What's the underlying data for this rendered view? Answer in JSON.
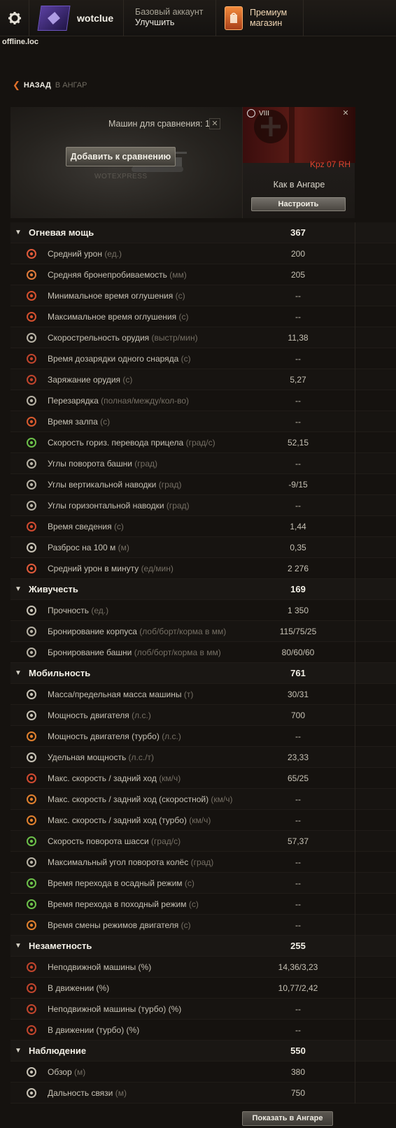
{
  "header": {
    "username": "wotclue",
    "account_type": "Базовый аккаунт",
    "upgrade": "Улучшить",
    "premium_line1": "Премиум",
    "premium_line2": "магазин",
    "server": "offline.loc"
  },
  "nav": {
    "back": "НАЗАД",
    "target": "В АНГАР"
  },
  "compare": {
    "label": "Машин для сравнения: 1",
    "add_button": "Добавить к сравнению",
    "watermark": "WOTEXPRESS"
  },
  "vehicle": {
    "tier": "VIII",
    "name": "Kpz 07 RH",
    "config": "Как в Ангаре",
    "setup_button": "Настроить",
    "accent": "#e0432e"
  },
  "categories": [
    {
      "name": "Огневая мощь",
      "value": "367",
      "stats": [
        {
          "label": "Средний урон",
          "unit": "(ед.)",
          "value": "200",
          "icon": "shell-damage-icon",
          "color": "#e05a3a"
        },
        {
          "label": "Средняя бронепробиваемость",
          "unit": "(мм)",
          "value": "205",
          "icon": "penetration-icon",
          "color": "#e07a3a"
        },
        {
          "label": "Минимальное время оглушения",
          "unit": "(с)",
          "value": "--",
          "icon": "stun-min-icon",
          "color": "#d4502e"
        },
        {
          "label": "Максимальное время оглушения",
          "unit": "(с)",
          "value": "--",
          "icon": "stun-max-icon",
          "color": "#d4502e"
        },
        {
          "label": "Скорострельность орудия",
          "unit": "(выстр/мин)",
          "value": "11,38",
          "icon": "rate-of-fire-icon",
          "color": "#b8b3a6"
        },
        {
          "label": "Время дозарядки одного снаряда",
          "unit": "(с)",
          "value": "--",
          "icon": "shell-reload-icon",
          "color": "#c0442c"
        },
        {
          "label": "Заряжание орудия",
          "unit": "(с)",
          "value": "5,27",
          "icon": "gun-loading-icon",
          "color": "#c0442c"
        },
        {
          "label": "Перезарядка",
          "unit": "(полная/между/кол-во)",
          "value": "--",
          "icon": "magazine-reload-icon",
          "color": "#b8b3a6"
        },
        {
          "label": "Время залпа",
          "unit": "(с)",
          "value": "--",
          "icon": "salvo-icon",
          "color": "#d85a2e"
        },
        {
          "label": "Скорость гориз. перевода прицела",
          "unit": "(град/с)",
          "value": "52,15",
          "icon": "traverse-speed-icon",
          "color": "#6cc04a"
        },
        {
          "label": "Углы поворота башни",
          "unit": "(град)",
          "value": "--",
          "icon": "turret-angle-icon",
          "color": "#b8b3a6"
        },
        {
          "label": "Углы вертикальной наводки",
          "unit": "(град)",
          "value": "-9/15",
          "icon": "elevation-icon",
          "color": "#b8b3a6"
        },
        {
          "label": "Углы горизонтальной наводки",
          "unit": "(град)",
          "value": "--",
          "icon": "horizontal-aim-icon",
          "color": "#b8b3a6"
        },
        {
          "label": "Время сведения",
          "unit": "(с)",
          "value": "1,44",
          "icon": "aim-time-icon",
          "color": "#d04a30"
        },
        {
          "label": "Разброс на 100 м",
          "unit": "(м)",
          "value": "0,35",
          "icon": "dispersion-icon",
          "color": "#c8c3b6"
        },
        {
          "label": "Средний урон в минуту",
          "unit": "(ед/мин)",
          "value": "2 276",
          "icon": "dpm-icon",
          "color": "#e05a3a"
        }
      ]
    },
    {
      "name": "Живучесть",
      "value": "169",
      "stats": [
        {
          "label": "Прочность",
          "unit": "(ед.)",
          "value": "1 350",
          "icon": "hitpoints-icon",
          "color": "#c8c3b6"
        },
        {
          "label": "Бронирование корпуса",
          "unit": "(лоб/борт/корма в мм)",
          "value": "115/75/25",
          "icon": "hull-armor-icon",
          "color": "#b8b3a6"
        },
        {
          "label": "Бронирование башни",
          "unit": "(лоб/борт/корма в мм)",
          "value": "80/60/60",
          "icon": "turret-armor-icon",
          "color": "#b8b3a6"
        }
      ]
    },
    {
      "name": "Мобильность",
      "value": "761",
      "stats": [
        {
          "label": "Масса/предельная масса машины",
          "unit": "(т)",
          "value": "30/31",
          "icon": "weight-icon",
          "color": "#c8c3b6"
        },
        {
          "label": "Мощность двигателя",
          "unit": "(л.с.)",
          "value": "700",
          "icon": "engine-power-icon",
          "color": "#c8c3b6"
        },
        {
          "label": "Мощность двигателя (турбо)",
          "unit": "(л.с.)",
          "value": "--",
          "icon": "engine-turbo-icon",
          "color": "#e0802e"
        },
        {
          "label": "Удельная мощность",
          "unit": "(л.с./т)",
          "value": "23,33",
          "icon": "power-ratio-icon",
          "color": "#c8c3b6"
        },
        {
          "label": "Макс. скорость / задний ход",
          "unit": "(км/ч)",
          "value": "65/25",
          "icon": "speed-icon",
          "color": "#d04a30"
        },
        {
          "label": "Макс. скорость / задний ход (скоростной)",
          "unit": "(км/ч)",
          "value": "--",
          "icon": "speed-fast-icon",
          "color": "#e0802e"
        },
        {
          "label": "Макс. скорость / задний ход (турбо)",
          "unit": "(км/ч)",
          "value": "--",
          "icon": "speed-turbo-icon",
          "color": "#e0802e"
        },
        {
          "label": "Скорость поворота шасси",
          "unit": "(град/с)",
          "value": "57,37",
          "icon": "hull-traverse-icon",
          "color": "#6cc04a"
        },
        {
          "label": "Максимальный угол поворота колёс",
          "unit": "(град)",
          "value": "--",
          "icon": "wheel-angle-icon",
          "color": "#b8b3a6"
        },
        {
          "label": "Время перехода в осадный режим",
          "unit": "(с)",
          "value": "--",
          "icon": "siege-mode-icon",
          "color": "#6cc04a"
        },
        {
          "label": "Время перехода в походный режим",
          "unit": "(с)",
          "value": "--",
          "icon": "travel-mode-icon",
          "color": "#6cc04a"
        },
        {
          "label": "Время смены режимов двигателя",
          "unit": "(с)",
          "value": "--",
          "icon": "engine-mode-icon",
          "color": "#e0802e"
        }
      ]
    },
    {
      "name": "Незаметность",
      "value": "255",
      "stats": [
        {
          "label": "Неподвижной машины (%)",
          "unit": "",
          "value": "14,36/3,23",
          "icon": "camo-stationary-icon",
          "color": "#c0442c"
        },
        {
          "label": "В движении (%)",
          "unit": "",
          "value": "10,77/2,42",
          "icon": "camo-moving-icon",
          "color": "#c0442c"
        },
        {
          "label": "Неподвижной машины (турбо) (%)",
          "unit": "",
          "value": "--",
          "icon": "camo-stationary-turbo-icon",
          "color": "#c0442c"
        },
        {
          "label": "В движении (турбо) (%)",
          "unit": "",
          "value": "--",
          "icon": "camo-moving-turbo-icon",
          "color": "#c0442c"
        }
      ]
    },
    {
      "name": "Наблюдение",
      "value": "550",
      "stats": [
        {
          "label": "Обзор",
          "unit": "(м)",
          "value": "380",
          "icon": "view-range-icon",
          "color": "#c8c3b6"
        },
        {
          "label": "Дальность связи",
          "unit": "(м)",
          "value": "750",
          "icon": "radio-range-icon",
          "color": "#c8c3b6"
        }
      ]
    }
  ],
  "footer": {
    "show_button": "Показать в Ангаре"
  }
}
